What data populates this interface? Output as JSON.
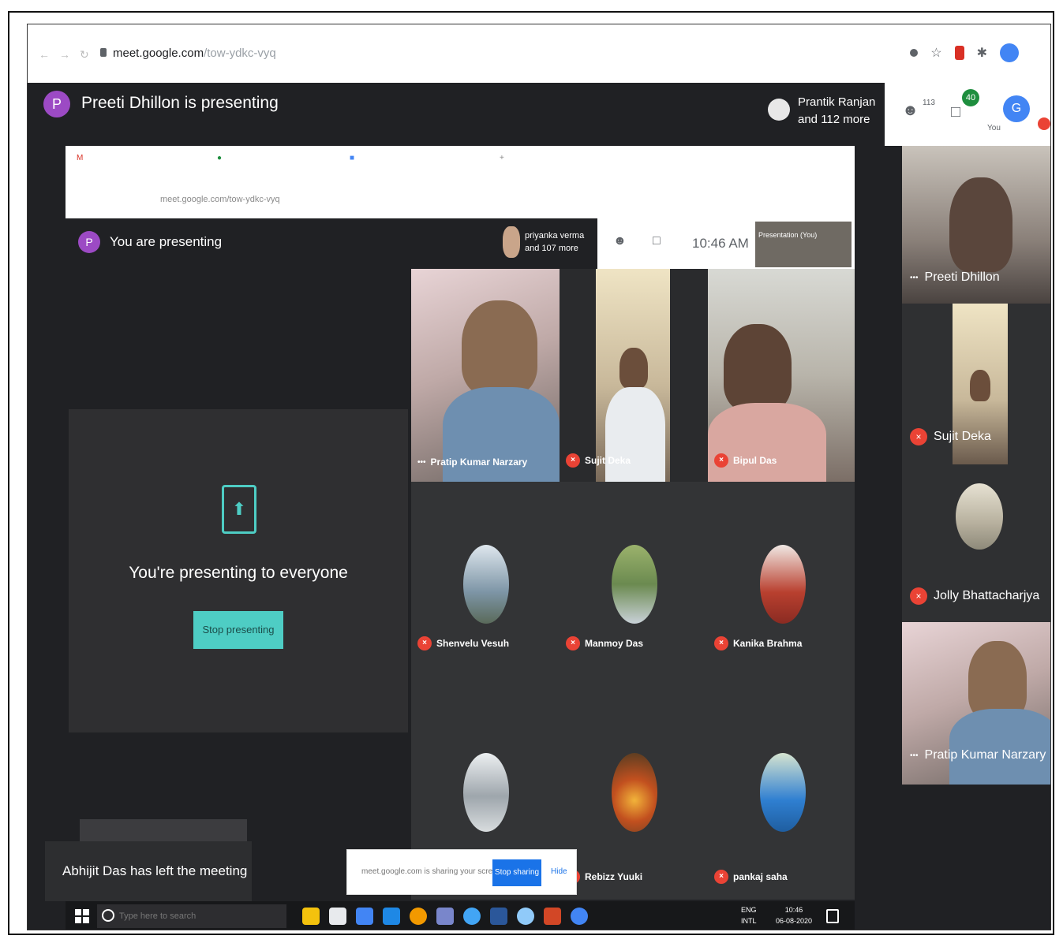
{
  "browser": {
    "url_host": "meet.google.com",
    "url_path": "/tow-ydkc-vyq"
  },
  "meet": {
    "presenter_initial": "P",
    "presenting_title": "Preeti Dhillon is presenting",
    "attendees_line1": "Prantik Ranjan",
    "attendees_line2": "and 112 more",
    "participants_count": "113",
    "chat_badge": "40",
    "self_initial": "G",
    "self_label": "You"
  },
  "shared_screen": {
    "inner_url": "meet.google.com/tow-ydkc-vyq",
    "presenter_initial": "P",
    "you_presenting": "You are presenting",
    "attendees_line1": "priyanka verma",
    "attendees_line2": "and 107 more",
    "time": "10:46 AM",
    "mini_tile_label": "Presentation (You)",
    "presenting_msg": "You're presenting to everyone",
    "stop_presenting": "Stop presenting",
    "participants": [
      {
        "name": "Pratip Kumar Narzary"
      },
      {
        "name": "Sujit Deka"
      },
      {
        "name": "Bipul Das"
      },
      {
        "name": "Shenvelu Vesuh"
      },
      {
        "name": "Manmoy Das"
      },
      {
        "name": "Kanika Brahma"
      },
      {
        "name": ""
      },
      {
        "name": "Rebizz Yuuki"
      },
      {
        "name": "pankaj saha"
      }
    ]
  },
  "sidebar": {
    "tiles": [
      {
        "name": "Preeti Dhillon"
      },
      {
        "name": "Sujit Deka"
      },
      {
        "name": "Jolly Bhattacharjya"
      },
      {
        "name": "Pratip Kumar Narzary"
      }
    ]
  },
  "toasts": {
    "left_meeting": "Abhijit Das has left the meeting",
    "sharing_text": "meet.google.com is sharing your screen.",
    "stop_sharing": "Stop sharing",
    "hide": "Hide"
  },
  "taskbar": {
    "search_placeholder": "Type here to search",
    "lang1": "ENG",
    "lang2": "INTL",
    "time": "10:46",
    "date": "06-08-2020"
  }
}
